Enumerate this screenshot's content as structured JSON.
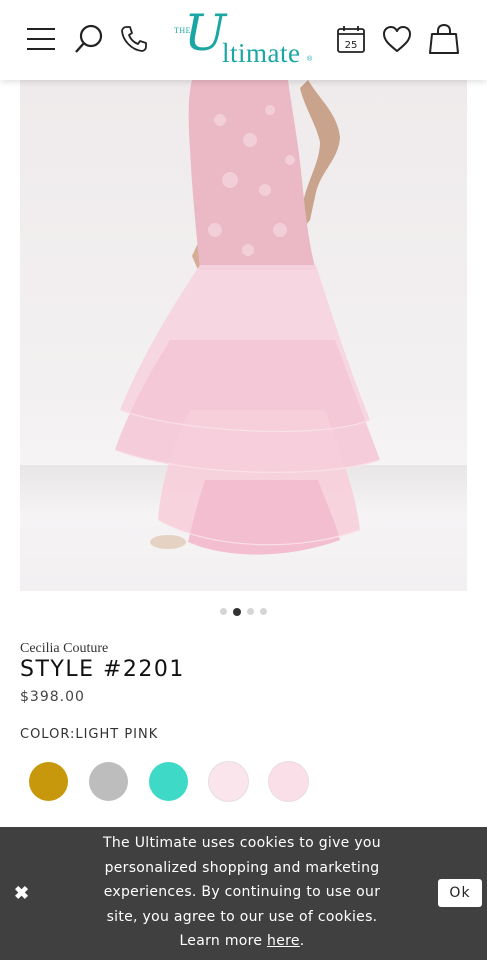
{
  "header": {
    "logo": {
      "the": "THE",
      "script_letter": "U",
      "rest": "ltimate",
      "reg": "®"
    },
    "calendar_day": "25"
  },
  "product": {
    "designer": "Cecilia Couture",
    "style": "STYLE #2201",
    "price": "$398.00",
    "color_label": "COLOR:",
    "color_value": "LIGHT PINK",
    "swatches": [
      {
        "name": "gold",
        "color": "#c8980c"
      },
      {
        "name": "silver",
        "color": "#bdbdbd"
      },
      {
        "name": "turquoise",
        "color": "#3fd9c7"
      },
      {
        "name": "light-pink",
        "color": "#fbe5ec",
        "selected": true
      },
      {
        "name": "pink",
        "color": "#fbdfe8"
      }
    ]
  },
  "carousel": {
    "count": 4,
    "active_index": 1
  },
  "cookie": {
    "message_part1": "The Ultimate uses cookies to give you personalized shopping and marketing experiences. By continuing to use our site, you agree to our use of cookies. Learn more",
    "link_text": "here",
    "message_end": ".",
    "ok_label": "Ok",
    "close_symbol": "✖"
  },
  "colors": {
    "brand_teal": "#1aa7a3",
    "dress_pink": "#f3c2d2",
    "banner_bg": "#404040"
  }
}
